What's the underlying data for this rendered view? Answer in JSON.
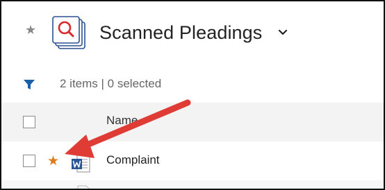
{
  "header": {
    "title": "Scanned Pleadings",
    "fav_star_glyph": "★",
    "library_icon": "library-search-icon",
    "dropdown_icon": "chevron-down-icon"
  },
  "filter_bar": {
    "filter_icon": "filter-icon",
    "count_text": "2 items | 0 selected"
  },
  "columns": {
    "name": "Name"
  },
  "rows": [
    {
      "name": "Complaint",
      "favorite": true,
      "type_icon": "word-document-icon"
    }
  ],
  "colors": {
    "favorite_star": "#e07b1a",
    "accent_blue": "#1a5fa8",
    "annotation_arrow": "#e03c36"
  }
}
